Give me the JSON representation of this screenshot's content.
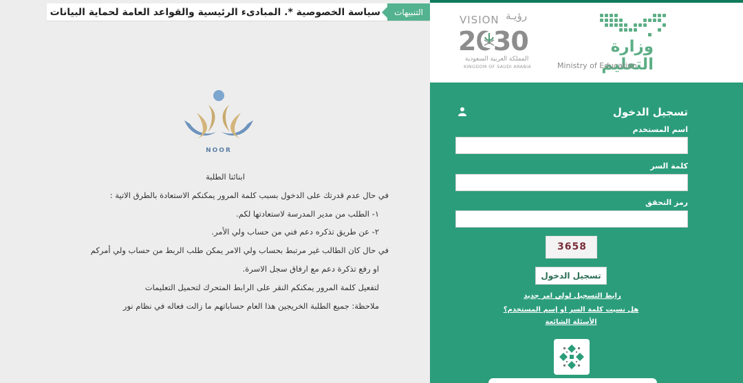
{
  "ticker": {
    "label": "التنبيهات",
    "text": "سياسة الخصوصية *. المبادىء الرئيسية والقواعد العامة لحماية البيانات الشخصية *. ا"
  },
  "logo": {
    "caption": "NOOR"
  },
  "notice": {
    "title": "ابنائنا الطلبة",
    "lines": [
      "في حال عدم قدرتك على الدخول بسبب كلمة المرور يمكنكم الاستعادة بالطرق الاتية :",
      "١- الطلب من مدير المدرسة لاستعادتها لكم.",
      "٢- عن طريق تذكره دعم فني من حساب ولي الأمر.",
      "في حال كان الطالب غير مرتبط بحساب ولي الامر يمكن طلب الربط من حساب ولي أمركم",
      "او رفع تذكرة دعم مع ارفاق سجل الاسرة.",
      "لتفعيل كلمة المرور يمكنكم النقر على الرابط المتحرك لتحميل التعليمات",
      "ملاحظة: جميع الطلبة الخريجين هذا العام حساباتهم ما زالت فعاله في نظام نور"
    ]
  },
  "ministry": {
    "name_ar": "وزارة التعليم",
    "name_en": "Ministry of Education"
  },
  "vision": {
    "word_ar": "رؤيـة",
    "word_en": "VISION",
    "year": "2030",
    "kingdom_ar": "المملكة العربية السعودية",
    "kingdom_en": "KINGDOM OF SAUDI ARABIA"
  },
  "login": {
    "title": "تسجيل الدخول",
    "username_label": "اسم المستخدم",
    "username_value": "",
    "password_label": "كلمة السر",
    "password_value": "",
    "code_label": "رمز التحقق",
    "code_value": "",
    "captcha": "3658",
    "submit": "تسجيل الدخول",
    "link_parent": "رابط التسجيل لولي امر جديد",
    "link_forgot": "هل نسيت كلمة السر او إسم المستخدم؟",
    "link_faq": "الأسئلة الشائعة"
  },
  "colors": {
    "panel": "#2b9d7a",
    "accent": "#53b28f",
    "ministry": "#5dae86"
  },
  "icons": [
    "user-icon",
    "noor-logo",
    "moe-logo",
    "vision-emblem",
    "qr-code-icon"
  ]
}
